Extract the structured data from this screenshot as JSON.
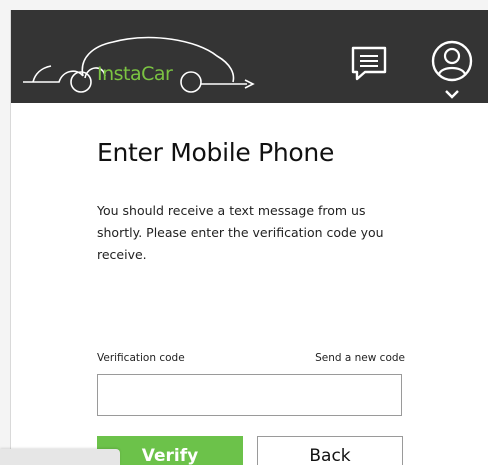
{
  "header": {
    "logo_text": "InstaCar",
    "background": "#343434",
    "accent": "#7bc442",
    "icons": [
      "message-icon",
      "account-icon",
      "chevron-down-icon"
    ]
  },
  "main": {
    "title": "Enter Mobile Phone",
    "description": "You should receive a text message from us shortly. Please enter the verification code you receive.",
    "field_label": "Verification code",
    "resend_label": "Send a new code",
    "code_value": "",
    "verify_label": "Verify",
    "verify_color": "#6cc24a",
    "back_label": "Back"
  }
}
